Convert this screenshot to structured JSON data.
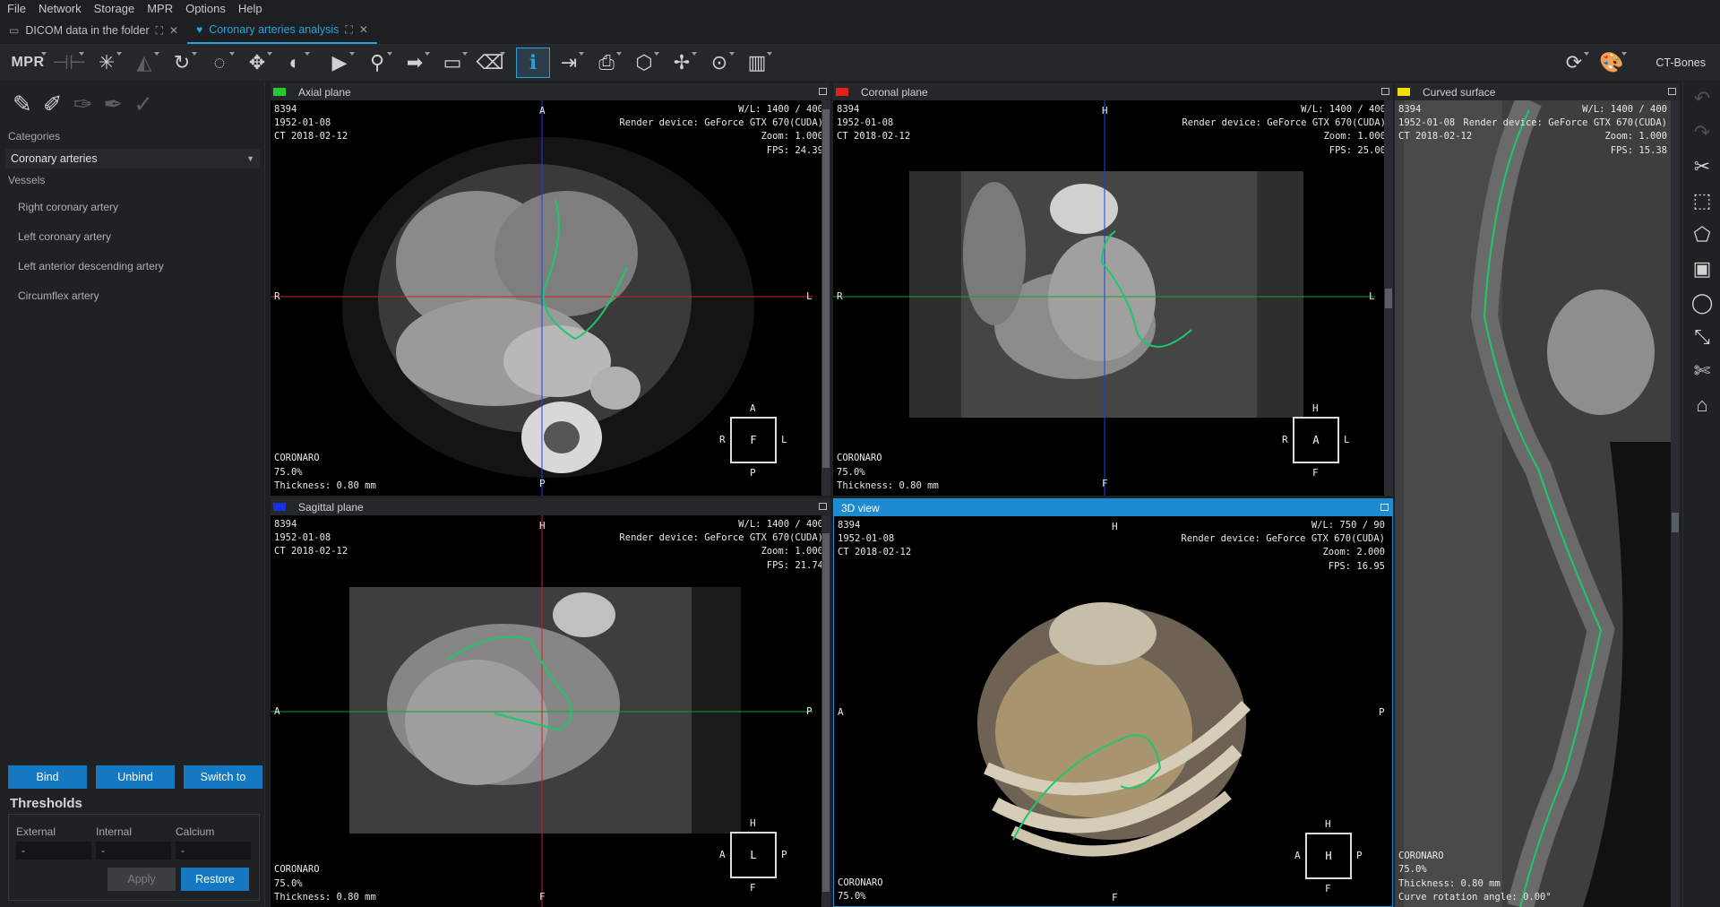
{
  "menu": [
    "File",
    "Network",
    "Storage",
    "MPR",
    "Options",
    "Help"
  ],
  "tabs": [
    {
      "label": "DICOM data in the folder",
      "active": false
    },
    {
      "label": "Coronary arteries analysis",
      "active": true
    }
  ],
  "toolbar": {
    "mpr_label": "MPR",
    "preset": "CT-Bones",
    "icons": [
      "mpr-mode-icon",
      "layout-icon",
      "crosshair-icon",
      "flip-icon",
      "rotate-icon",
      "zoom-icon",
      "pan-icon",
      "window-level-icon",
      "play-icon",
      "pin-icon",
      "arrow-icon",
      "ruler-icon",
      "eraser-icon",
      "info-icon",
      "export-icon",
      "print-icon",
      "cube-icon",
      "orient-icon",
      "reset-icon",
      "slices-icon",
      "settings-icon",
      "palette-icon"
    ]
  },
  "left": {
    "categories_label": "Categories",
    "category_value": "Coronary arteries",
    "vessels_label": "Vessels",
    "vessels": [
      "Right coronary artery",
      "Left coronary artery",
      "Left anterior descending artery",
      "Circumflex artery"
    ],
    "buttons": {
      "bind": "Bind",
      "unbind": "Unbind",
      "switch": "Switch to"
    },
    "thresholds": {
      "title": "Thresholds",
      "external_label": "External",
      "internal_label": "Internal",
      "calcium_label": "Calcium",
      "external_value": "-",
      "internal_value": "-",
      "calcium_value": "-",
      "apply": "Apply",
      "restore": "Restore"
    }
  },
  "viewports": {
    "axial": {
      "title": "Axial plane",
      "color": "#1fcc2a",
      "tl": "8394\n1952-01-08\nCT 2018-02-12",
      "tr": "W/L: 1400 / 400\nRender device: GeForce GTX 670(CUDA)\nZoom: 1.000\nFPS: 24.39",
      "bl": "CORONARO\n75.0%\nThickness: 0.80 mm",
      "ori": {
        "top": "A",
        "bottom": "P",
        "left": "R",
        "right": "L"
      },
      "cube": {
        "center": "F",
        "top": "A",
        "bottom": "P",
        "left": "R",
        "right": "L"
      }
    },
    "coronal": {
      "title": "Coronal plane",
      "color": "#e81c1c",
      "tl": "8394\n1952-01-08\nCT 2018-02-12",
      "tr": "W/L: 1400 / 400\nRender device: GeForce GTX 670(CUDA)\nZoom: 1.000\nFPS: 25.00",
      "bl": "CORONARO\n75.0%\nThickness: 0.80 mm",
      "ori": {
        "top": "H",
        "bottom": "F",
        "left": "R",
        "right": "L"
      },
      "cube": {
        "center": "A",
        "top": "H",
        "bottom": "F",
        "left": "R",
        "right": "L"
      }
    },
    "curved": {
      "title": "Curved surface",
      "color": "#f0e000",
      "tl": "8394\n1952-01-08\nCT 2018-02-12",
      "tr": "W/L: 1400 / 400\nRender device: GeForce GTX 670(CUDA)\nZoom: 1.000\nFPS: 15.38",
      "bl": "CORONARO\n75.0%\nThickness: 0.80 mm\nCurve rotation angle: 0.00°"
    },
    "sagittal": {
      "title": "Sagittal plane",
      "color": "#1a2fe0",
      "tl": "8394\n1952-01-08\nCT 2018-02-12",
      "tr": "W/L: 1400 / 400\nRender device: GeForce GTX 670(CUDA)\nZoom: 1.000\nFPS: 21.74",
      "bl": "CORONARO\n75.0%\nThickness: 0.80 mm",
      "ori": {
        "top": "H",
        "bottom": "F",
        "left": "A",
        "right": "P"
      },
      "cube": {
        "center": "L",
        "top": "H",
        "bottom": "F",
        "left": "A",
        "right": "P"
      }
    },
    "view3d": {
      "title": "3D view",
      "tl": "8394\n1952-01-08\nCT 2018-02-12",
      "tr": "W/L: 750 / 90\nRender device: GeForce GTX 670(CUDA)\nZoom: 2.000\nFPS: 16.95",
      "bl": "CORONARO\n75.0%",
      "ori": {
        "top": "H",
        "bottom": "F",
        "left": "A",
        "right": "P"
      },
      "cube": {
        "center": "H",
        "top": "H",
        "bottom": "F",
        "left": "A",
        "right": "P"
      }
    }
  }
}
